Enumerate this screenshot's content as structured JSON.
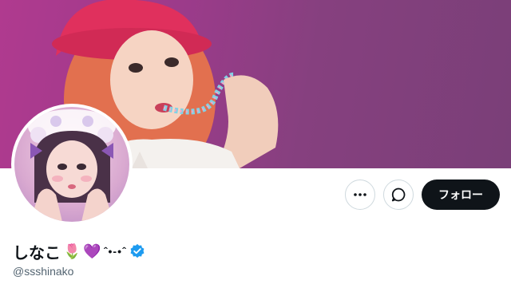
{
  "profile": {
    "display_name": "しなこ",
    "emoji_1": "🌷",
    "emoji_2": "💜",
    "kaomoji": "ˆ•-•ˆ",
    "handle": "@ssshinako",
    "verified": true
  },
  "actions": {
    "more_icon": "more-horizontal-icon",
    "message_icon": "message-bubble-icon",
    "follow_label": "フォロー"
  },
  "colors": {
    "banner": "#9b3b8a",
    "follow_button_bg": "#0f1419",
    "verified_badge": "#1d9bf0",
    "handle_text": "#536471"
  }
}
